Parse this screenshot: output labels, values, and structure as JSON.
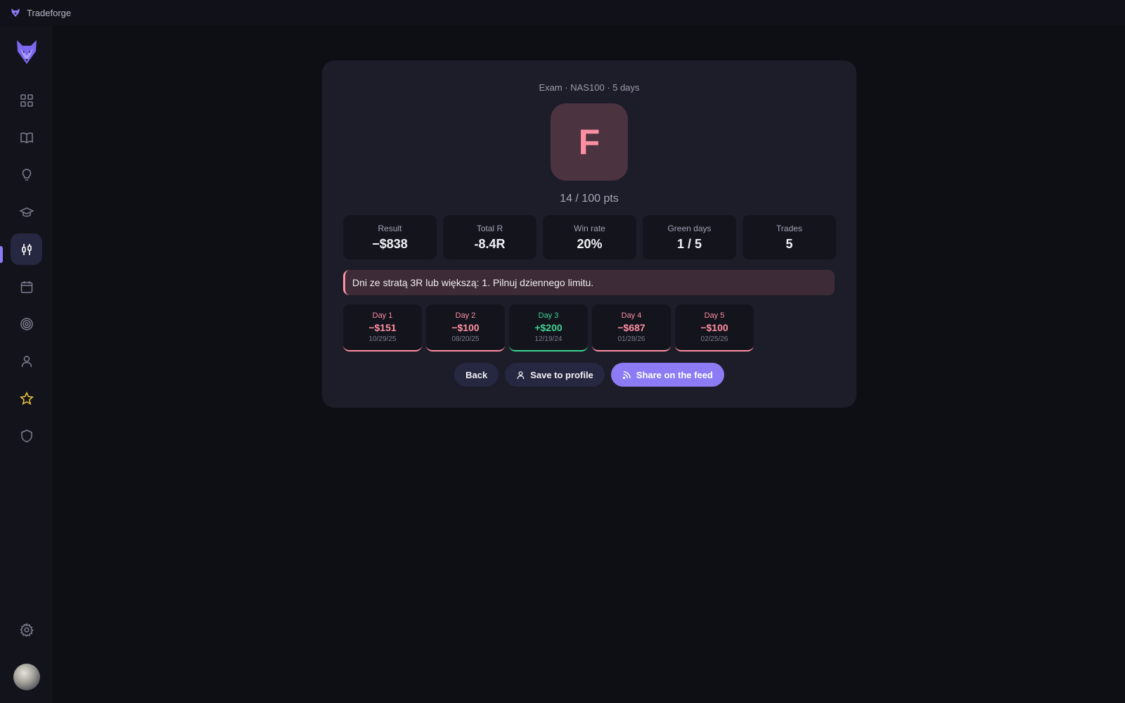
{
  "app": {
    "title": "Tradeforge",
    "icon": "fox-logo-icon"
  },
  "sidebar": {
    "items": [
      {
        "name": "dashboard",
        "icon": "grid-icon",
        "active": false
      },
      {
        "name": "journal",
        "icon": "book-icon",
        "active": false
      },
      {
        "name": "ideas",
        "icon": "lightbulb-icon",
        "active": false
      },
      {
        "name": "academy",
        "icon": "graduation-cap-icon",
        "active": false
      },
      {
        "name": "exam",
        "icon": "candlestick-icon",
        "active": true
      },
      {
        "name": "calendar",
        "icon": "calendar-icon",
        "active": false
      },
      {
        "name": "goals",
        "icon": "target-icon",
        "active": false
      },
      {
        "name": "profile",
        "icon": "user-icon",
        "active": false
      },
      {
        "name": "favorites",
        "icon": "star-icon",
        "active": false
      },
      {
        "name": "security",
        "icon": "shield-icon",
        "active": false
      }
    ],
    "bottom": [
      {
        "name": "settings",
        "icon": "gear-icon"
      },
      {
        "name": "avatar",
        "icon": "avatar"
      }
    ]
  },
  "exam": {
    "subtitle": "Exam · NAS100 · 5 days",
    "grade": "F",
    "score": "14 / 100 pts",
    "stats": [
      {
        "label": "Result",
        "value": "−$838"
      },
      {
        "label": "Total R",
        "value": "-8.4R"
      },
      {
        "label": "Win rate",
        "value": "20%"
      },
      {
        "label": "Green days",
        "value": "1 / 5"
      },
      {
        "label": "Trades",
        "value": "5"
      }
    ],
    "alert": "Dni ze stratą 3R lub większą: 1. Pilnuj dziennego limitu.",
    "days": [
      {
        "label": "Day 1",
        "value": "−$151",
        "date": "10/29/25",
        "outcome": "loss"
      },
      {
        "label": "Day 2",
        "value": "−$100",
        "date": "08/20/25",
        "outcome": "loss"
      },
      {
        "label": "Day 3",
        "value": "+$200",
        "date": "12/19/24",
        "outcome": "win"
      },
      {
        "label": "Day 4",
        "value": "−$687",
        "date": "01/28/26",
        "outcome": "loss"
      },
      {
        "label": "Day 5",
        "value": "−$100",
        "date": "02/25/26",
        "outcome": "loss"
      }
    ],
    "buttons": {
      "back": "Back",
      "save": "Save to profile",
      "share": "Share on the feed"
    }
  },
  "colors": {
    "accent": "#8b7cf6",
    "loss": "#ff8fa3",
    "win": "#3ed494",
    "star": "#f5c842"
  }
}
